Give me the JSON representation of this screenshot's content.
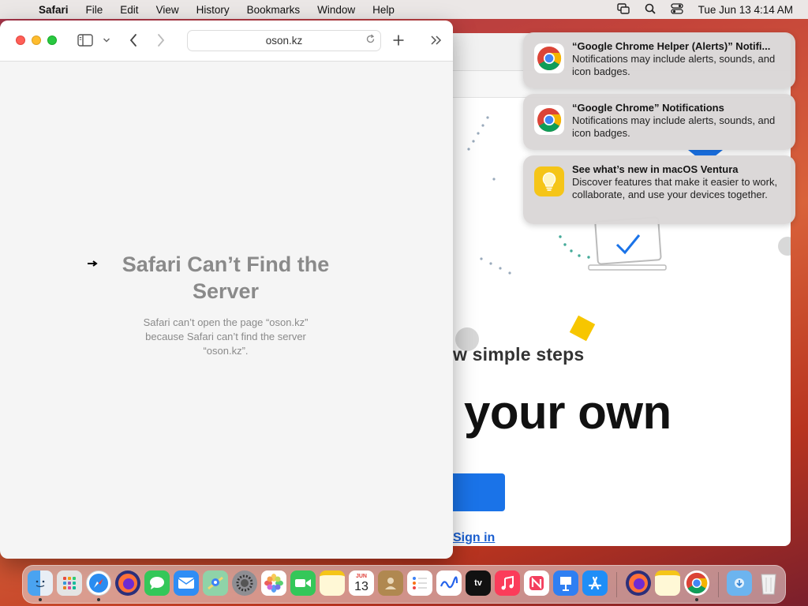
{
  "menubar": {
    "apple_glyph": "",
    "app": "Safari",
    "items": [
      "File",
      "Edit",
      "View",
      "History",
      "Bookmarks",
      "Window",
      "Help"
    ],
    "clock": "Tue Jun 13  4:14 AM",
    "status_icons": [
      "screen-mirroring-icon",
      "search-icon",
      "control-center-icon"
    ]
  },
  "safari": {
    "url": "oson.kz",
    "error_title": "Safari Can’t Find the Server",
    "error_body": "Safari can’t open the page “oson.kz” because Safari can’t find the server “oson.kz”."
  },
  "background_page": {
    "steps_text": "w simple steps",
    "headline": "your own",
    "signin_link": "Sign in"
  },
  "notifications": [
    {
      "icon": "chrome-icon",
      "title": "“Google Chrome Helper (Alerts)” Notifi...",
      "body": "Notifications may include alerts, sounds, and icon badges."
    },
    {
      "icon": "chrome-icon",
      "title": "“Google Chrome” Notifications",
      "body": "Notifications may include alerts, sounds, and icon badges."
    },
    {
      "icon": "tips-icon",
      "title": "See what’s new in macOS Ventura",
      "body": "Discover features that make it easier to work, collaborate, and use your devices together."
    }
  ],
  "dock": {
    "calendar_month": "JUN",
    "calendar_day": "13",
    "tv_label": "tv",
    "apps": [
      "Finder",
      "Launchpad",
      "Safari",
      "Firefox",
      "Messages",
      "Mail",
      "Maps",
      "System Settings",
      "Photos",
      "FaceTime",
      "Notes",
      "Calendar",
      "Contacts",
      "Reminders",
      "Freeform",
      "TV",
      "Music",
      "News",
      "Keynote",
      "App Store",
      "Firefox",
      "Notes",
      "Chrome",
      "Downloads",
      "Trash"
    ]
  },
  "colors": {
    "accent_blue": "#1a73e8",
    "link_blue": "#1a5fd0",
    "traffic_red": "#ff5f57",
    "traffic_yellow": "#febc2e",
    "traffic_green": "#28c840"
  }
}
